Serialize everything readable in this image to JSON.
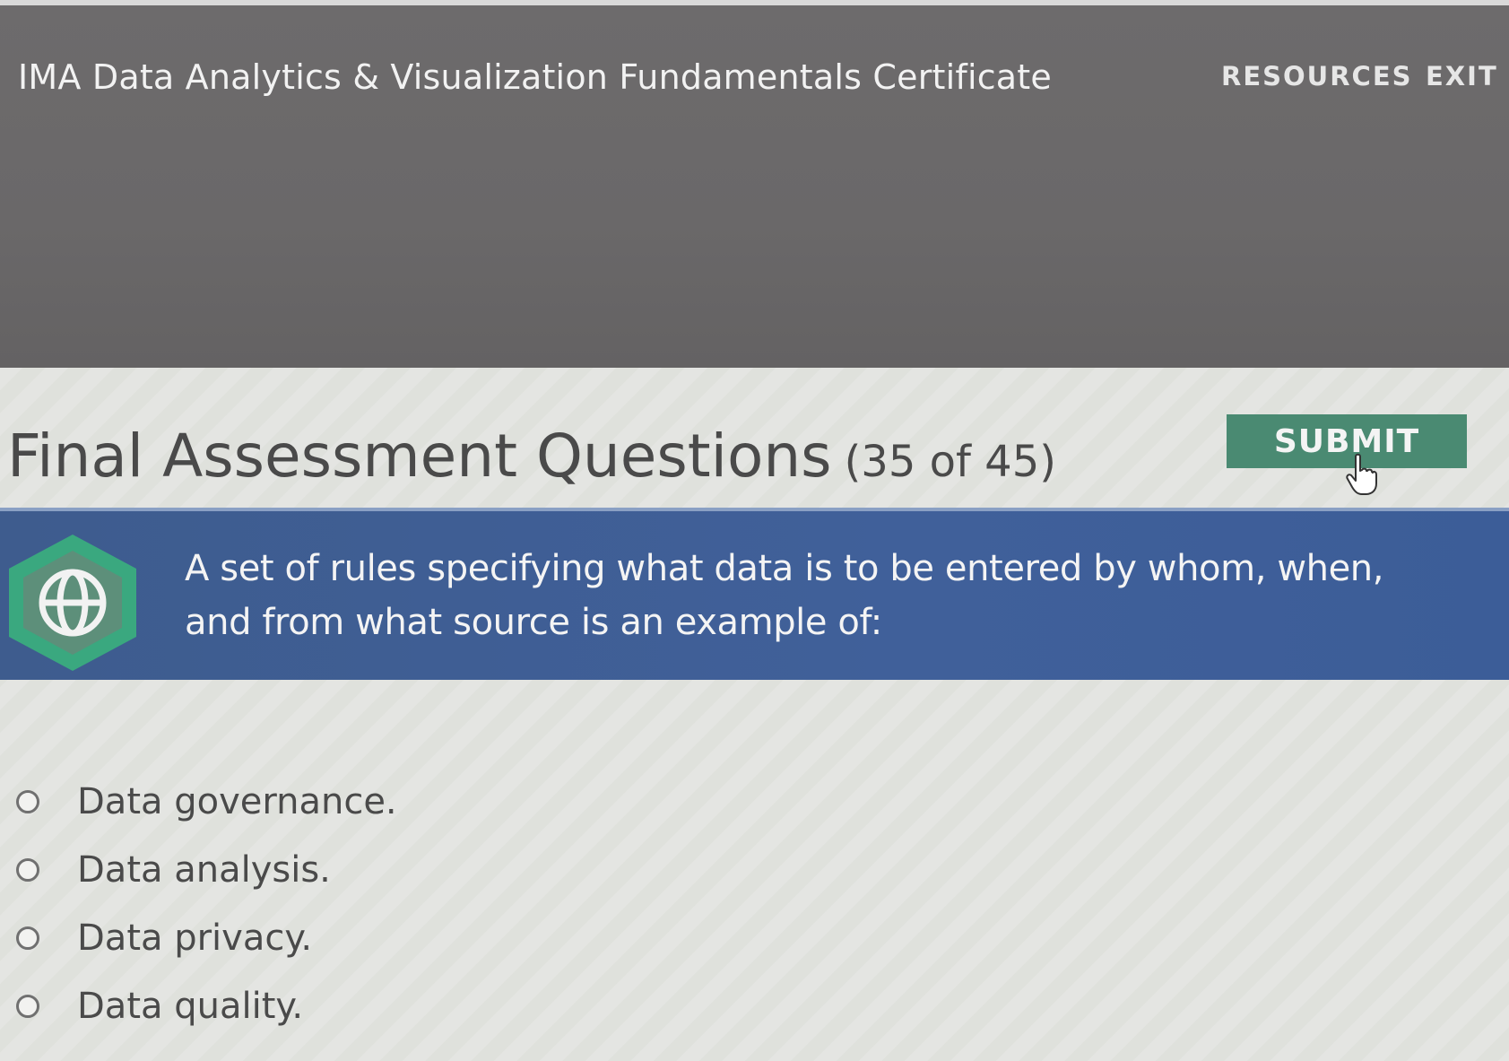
{
  "header": {
    "course_title": "IMA Data Analytics & Visualization Fundamentals Certificate",
    "nav": {
      "resources": "RESOURCES",
      "exit": "EXIT"
    }
  },
  "assessment": {
    "title": "Final Assessment Questions",
    "progress": "(35 of 45)",
    "submit_label": "SUBMIT"
  },
  "question": {
    "icon": "globe-icon",
    "text": "A set of rules specifying what data is to be entered by whom, when, and from what source is an example of:"
  },
  "options": [
    {
      "label": "Data governance."
    },
    {
      "label": "Data analysis."
    },
    {
      "label": "Data privacy."
    },
    {
      "label": "Data quality."
    }
  ],
  "colors": {
    "header_bg": "#6a6869",
    "submit_bg": "#4a8a72",
    "question_bg": "#40609a",
    "badge_outer": "#3aa87f",
    "badge_inner": "#5d8f7a"
  }
}
